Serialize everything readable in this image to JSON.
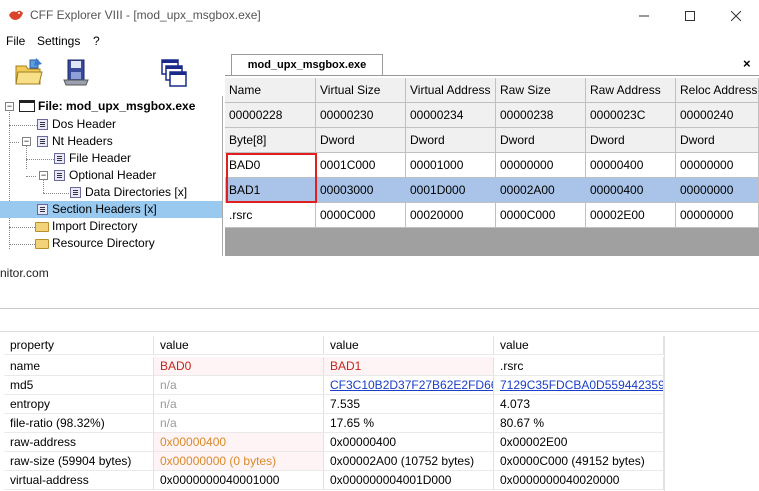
{
  "window": {
    "title": "CFF Explorer VIII - [mod_upx_msgbox.exe]"
  },
  "menu": [
    "File",
    "Settings",
    "?"
  ],
  "toolbar": {
    "icons": [
      "open-file-icon",
      "save-disk-icon",
      "windows-icon"
    ]
  },
  "tree": {
    "root": "File: mod_upx_msgbox.exe",
    "items": [
      "Dos Header",
      "Nt Headers",
      "File Header",
      "Optional Header",
      "Data Directories [x]",
      "Section Headers [x]",
      "Import Directory",
      "Resource Directory"
    ]
  },
  "tab": {
    "label": "mod_upx_msgbox.exe",
    "close": "×"
  },
  "grid": {
    "columns": [
      "Name",
      "Virtual Size",
      "Virtual Address",
      "Raw Size",
      "Raw Address",
      "Reloc Address"
    ],
    "offsets": [
      "00000228",
      "00000230",
      "00000234",
      "00000238",
      "0000023C",
      "00000240"
    ],
    "types": [
      "Byte[8]",
      "Dword",
      "Dword",
      "Dword",
      "Dword",
      "Dword"
    ],
    "rows": [
      [
        "BAD0",
        "0001C000",
        "00001000",
        "00000000",
        "00000400",
        "00000000"
      ],
      [
        "BAD1",
        "00003000",
        "0001D000",
        "00002A00",
        "00000400",
        "00000000"
      ],
      [
        ".rsrc",
        "0000C000",
        "00020000",
        "0000C000",
        "00002E00",
        "00000000"
      ]
    ]
  },
  "url_text": "nitor.com",
  "properties": {
    "headers": [
      "property",
      "value",
      "value",
      "value"
    ],
    "rows": [
      [
        "name",
        "BAD0",
        "BAD1",
        ".rsrc"
      ],
      [
        "md5",
        "n/a",
        "CF3C10B2D37F27B62E2FD66...",
        "7129C35FDCBA0D559442359..."
      ],
      [
        "entropy",
        "n/a",
        "7.535",
        "4.073"
      ],
      [
        "file-ratio (98.32%)",
        "n/a",
        "17.65 %",
        "80.67 %"
      ],
      [
        "raw-address",
        "0x00000400",
        "0x00000400",
        "0x00002E00"
      ],
      [
        "raw-size (59904 bytes)",
        "0x00000000 (0 bytes)",
        "0x00002A00 (10752 bytes)",
        "0x0000C000 (49152 bytes)"
      ],
      [
        "virtual-address",
        "0x0000000040001000",
        "0x000000004001D000",
        "0x0000000040020000"
      ]
    ]
  },
  "colors": {
    "selected_row": "#a9c4e8",
    "tree_selected": "#99c9ef",
    "highlight_box": "#e02020",
    "flag_red": "#c0261c",
    "flag_orange": "#d98a2a",
    "link_blue": "#1a3ec8"
  }
}
